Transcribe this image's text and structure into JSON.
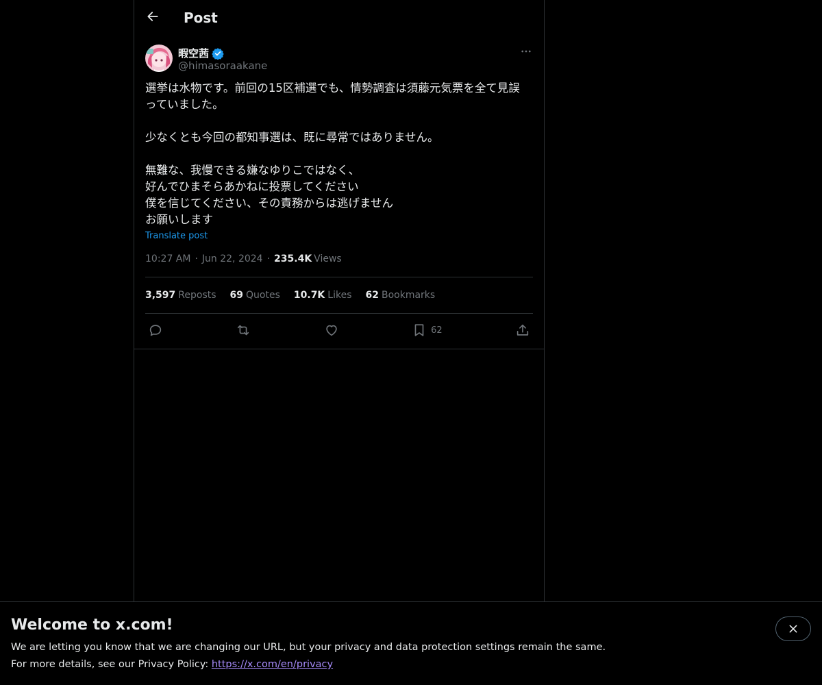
{
  "header": {
    "title": "Post"
  },
  "post": {
    "author": {
      "name": "暇空茜",
      "handle": "@himasoraakane",
      "verified": true
    },
    "text_lines": [
      "選挙は水物です。前回の15区補選でも、情勢調査は須藤元気票を全て見誤",
      "っていました。",
      "",
      "少なくとも今回の都知事選は、既に尋常ではありません。",
      "",
      "無難な、我慢できる嫌なゆりこではなく、",
      "好んでひまそらあかねに投票してください",
      "僕を信じてください、その責務からは逃げません",
      "お願いします"
    ],
    "translate_label": "Translate post",
    "time": "10:27 AM",
    "date": "Jun 22, 2024",
    "views_count": "235.4K",
    "views_label": "Views",
    "dot": "·"
  },
  "stats": {
    "reposts": {
      "count": "3,597",
      "label": "Reposts"
    },
    "quotes": {
      "count": "69",
      "label": "Quotes"
    },
    "likes": {
      "count": "10.7K",
      "label": "Likes"
    },
    "bookmarks": {
      "count": "62",
      "label": "Bookmarks"
    }
  },
  "actions": {
    "bookmark_count": "62"
  },
  "banner": {
    "title": "Welcome to x.com!",
    "line1": "We are letting you know that we are changing our URL, but your privacy and data protection settings remain the same.",
    "line2_prefix": "For more details, see our Privacy Policy: ",
    "link_text": "https://x.com/en/privacy"
  },
  "colors": {
    "background": "#000000",
    "text": "#e7e9ea",
    "muted": "#71767b",
    "accent": "#1d9bf0",
    "border": "#2f3336",
    "link": "#a78bfa"
  },
  "icons": {
    "back": "arrow-left-icon",
    "verified": "verified-badge-icon",
    "more": "more-horizontal-icon",
    "reply": "reply-icon",
    "repost": "repost-icon",
    "like": "heart-icon",
    "bookmark": "bookmark-icon",
    "share": "share-icon",
    "close": "close-icon"
  }
}
